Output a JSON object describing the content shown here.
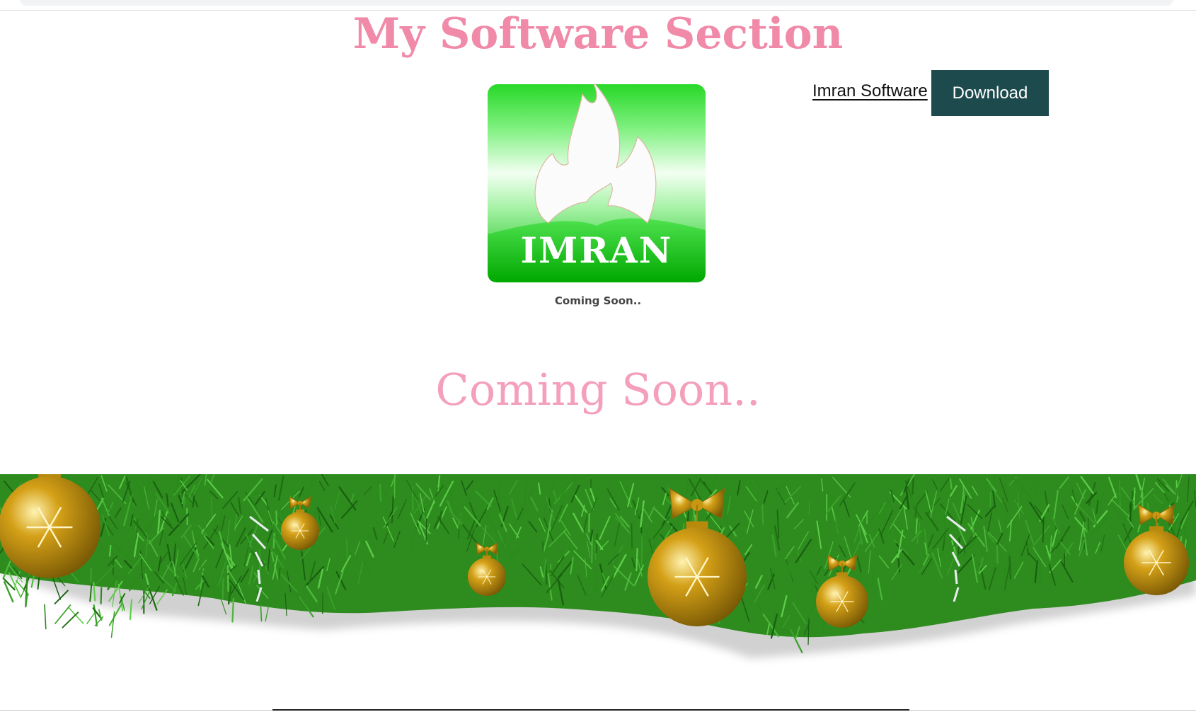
{
  "header": {
    "title": "My Software Section",
    "nav_link_label": "Imran Software",
    "download_label": "Download"
  },
  "logo": {
    "text": "IMRAN",
    "caption": "Coming Soon.."
  },
  "main": {
    "heading": "Coming Soon.."
  },
  "colors": {
    "title_pink": "#f08aa8",
    "heading_pink": "#f4a0bb",
    "button_bg": "#1d4a4d",
    "logo_green": "#22d622",
    "pine_green": "#2e8b1e",
    "ornament_gold": "#d4a017"
  },
  "decorations": {
    "banner": "christmas-garland",
    "ornaments": "gold-bauble-icon",
    "bows": "gold-bow-icon"
  }
}
